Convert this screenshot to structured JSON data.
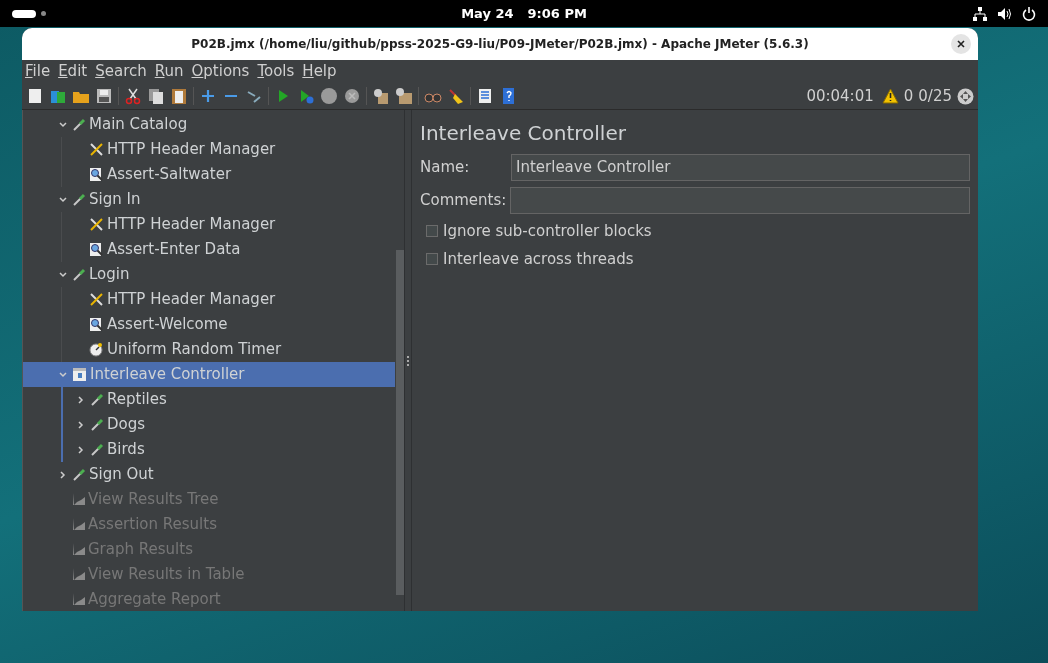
{
  "top_bar": {
    "date": "May 24",
    "time": "9:06 PM"
  },
  "window": {
    "title": "P02B.jmx (/home/liu/github/ppss-2025-G9-liu/P09-JMeter/P02B.jmx) - Apache JMeter (5.6.3)"
  },
  "menu": [
    {
      "mnemonic": "F",
      "rest": "ile"
    },
    {
      "mnemonic": "E",
      "rest": "dit"
    },
    {
      "mnemonic": "S",
      "rest": "earch"
    },
    {
      "mnemonic": "R",
      "rest": "un"
    },
    {
      "mnemonic": "O",
      "rest": "ptions"
    },
    {
      "mnemonic": "T",
      "rest": "ools"
    },
    {
      "mnemonic": "H",
      "rest": "elp"
    }
  ],
  "status": {
    "elapsed": "00:04:01",
    "warnings": "0",
    "threads": "0/25"
  },
  "tree": [
    {
      "label": "Main Catalog",
      "kind": "sampler",
      "expanded": true,
      "selected": false,
      "disabled": false,
      "children": [
        {
          "label": "HTTP Header Manager",
          "kind": "config",
          "selected": false,
          "disabled": false
        },
        {
          "label": "Assert-Saltwater",
          "kind": "assertion",
          "selected": false,
          "disabled": false
        }
      ]
    },
    {
      "label": "Sign In",
      "kind": "sampler",
      "expanded": true,
      "selected": false,
      "disabled": false,
      "children": [
        {
          "label": "HTTP Header Manager",
          "kind": "config",
          "selected": false,
          "disabled": false
        },
        {
          "label": "Assert-Enter Data",
          "kind": "assertion",
          "selected": false,
          "disabled": false
        }
      ]
    },
    {
      "label": "Login",
      "kind": "sampler",
      "expanded": true,
      "selected": false,
      "disabled": false,
      "children": [
        {
          "label": "HTTP Header Manager",
          "kind": "config",
          "selected": false,
          "disabled": false
        },
        {
          "label": "Assert-Welcome",
          "kind": "assertion",
          "selected": false,
          "disabled": false
        },
        {
          "label": "Uniform Random Timer",
          "kind": "timer",
          "selected": false,
          "disabled": false
        }
      ]
    },
    {
      "label": "Interleave Controller",
      "kind": "controller",
      "expanded": true,
      "selected": true,
      "disabled": false,
      "children": [
        {
          "label": "Reptiles",
          "kind": "sampler",
          "expanded": false,
          "selected": false,
          "disabled": false
        },
        {
          "label": "Dogs",
          "kind": "sampler",
          "expanded": false,
          "selected": false,
          "disabled": false
        },
        {
          "label": "Birds",
          "kind": "sampler",
          "expanded": false,
          "selected": false,
          "disabled": false
        }
      ]
    },
    {
      "label": "Sign Out",
      "kind": "sampler",
      "expanded": false,
      "selected": false,
      "disabled": false
    },
    {
      "label": "View Results Tree",
      "kind": "listener",
      "selected": false,
      "disabled": true
    },
    {
      "label": "Assertion Results",
      "kind": "listener",
      "selected": false,
      "disabled": true
    },
    {
      "label": "Graph Results",
      "kind": "listener",
      "selected": false,
      "disabled": true
    },
    {
      "label": "View Results in Table",
      "kind": "listener",
      "selected": false,
      "disabled": true
    },
    {
      "label": "Aggregate Report",
      "kind": "listener",
      "selected": false,
      "disabled": true
    }
  ],
  "panel": {
    "title": "Interleave Controller",
    "name_label": "Name:",
    "name_value": "Interleave Controller",
    "comments_label": "Comments:",
    "options": [
      {
        "label": "Ignore sub-controller blocks",
        "checked": false
      },
      {
        "label": "Interleave across threads",
        "checked": false
      }
    ]
  }
}
